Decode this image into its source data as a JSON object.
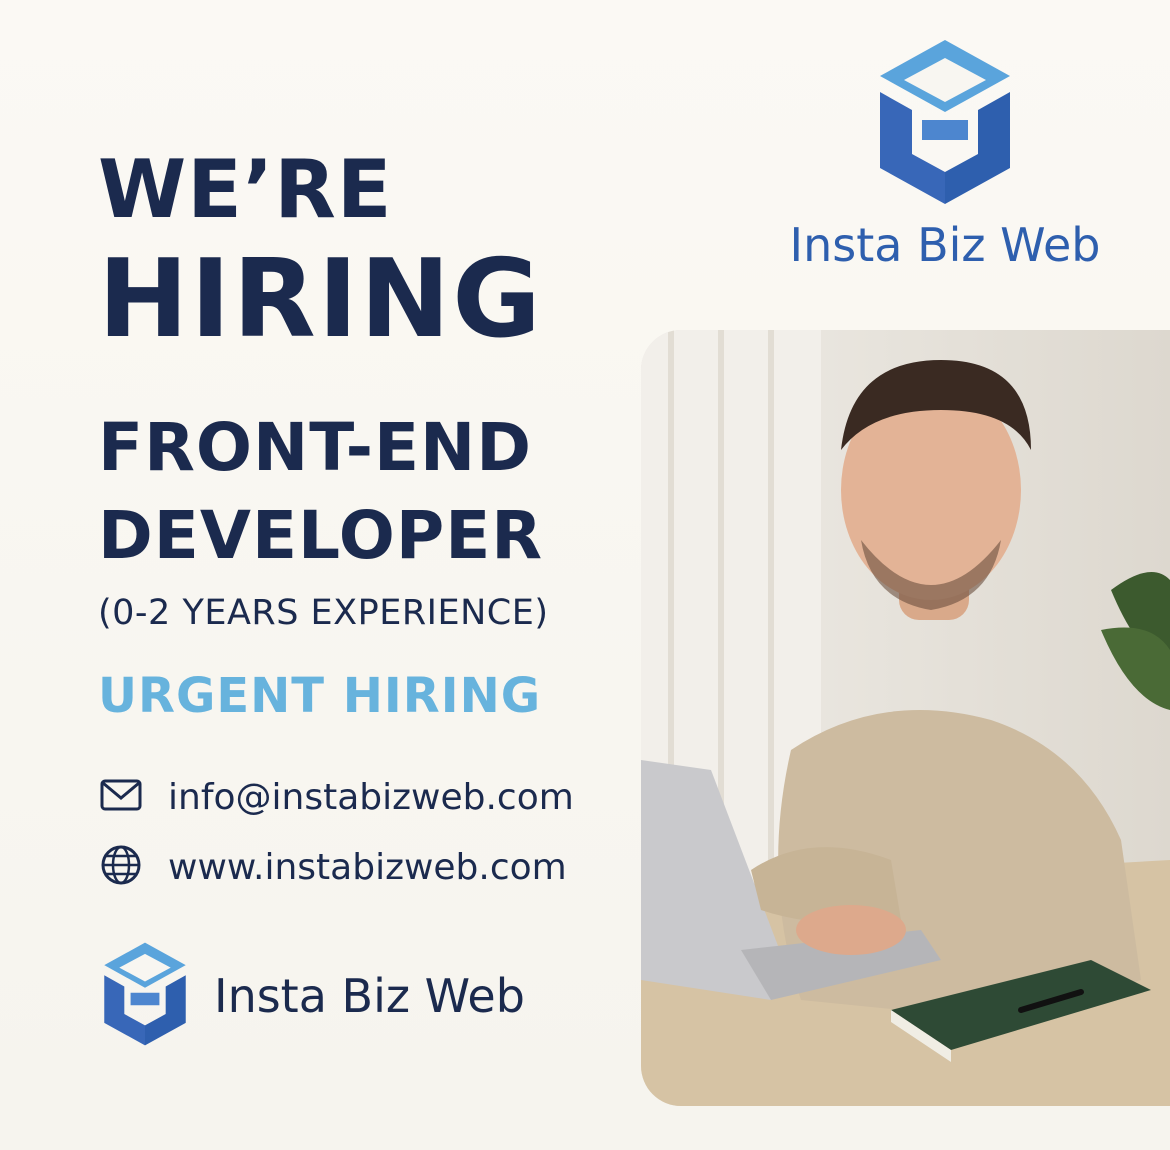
{
  "headline": {
    "line1": "WE’RE",
    "line2": "HIRING",
    "line3": "FRONT-END",
    "line4": "DEVELOPER",
    "experience": "(0-2 YEARS EXPERIENCE)",
    "urgent": "URGENT HIRING"
  },
  "contact": {
    "email": "info@instabizweb.com",
    "email_icon": "mail-icon",
    "website": "www.instabizweb.com",
    "website_icon": "globe-icon"
  },
  "brand": {
    "name": "Insta Biz Web",
    "logo_icon": "hexagon-logo-icon"
  },
  "colors": {
    "navy": "#1b2a4e",
    "accent_light_blue": "#67b3dd",
    "brand_blue": "#2e5fae",
    "background": "#f8f6f1"
  }
}
